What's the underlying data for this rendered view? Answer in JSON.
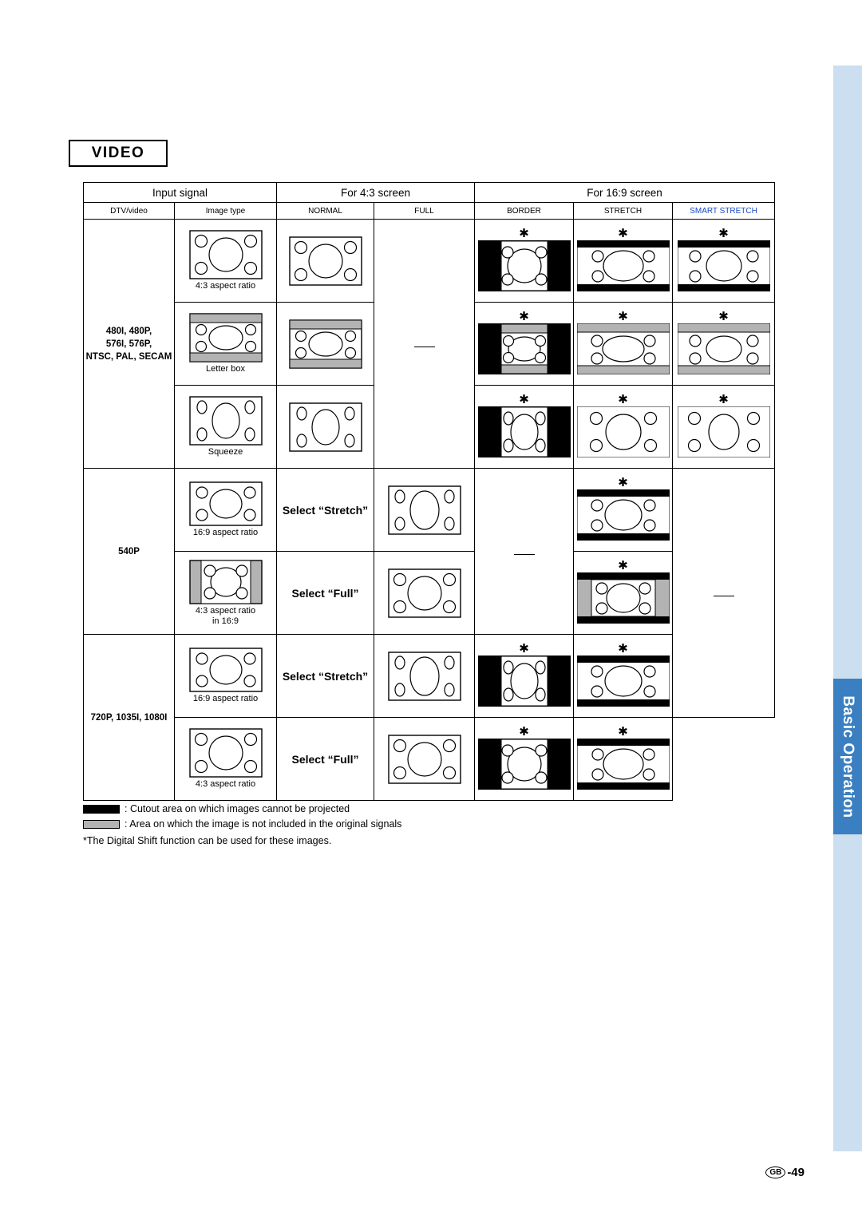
{
  "page": {
    "section_title": "VIDEO",
    "side_tab_label": "Basic Operation",
    "page_number": "-49",
    "page_region": "GB"
  },
  "table": {
    "group_headers": {
      "input_signal": "Input signal",
      "for_4_3": "For 4:3 screen",
      "for_16_9": "For 16:9 screen"
    },
    "column_headers": {
      "dtv_video": "DTV/video",
      "image_type": "Image type",
      "normal": "NORMAL",
      "full": "FULL",
      "border": "BORDER",
      "stretch": "STRETCH",
      "smart_stretch": "SMART STRETCH"
    },
    "rows": [
      {
        "signal": "480I, 480P,\n576I, 576P,\nNTSC, PAL, SECAM",
        "items": [
          {
            "image_type": "4:3 aspect ratio",
            "normal": "",
            "full": "",
            "border": "",
            "stretch": "",
            "smart_stretch": ""
          },
          {
            "image_type": "Letter box",
            "normal": "",
            "full": "",
            "border": "",
            "stretch": "",
            "smart_stretch": ""
          },
          {
            "image_type": "Squeeze",
            "normal": "",
            "full": "",
            "border": "",
            "stretch": "",
            "smart_stretch": ""
          }
        ]
      },
      {
        "signal": "540P",
        "items": [
          {
            "image_type": "16:9 aspect ratio",
            "normal": "Select “Stretch”",
            "full": "",
            "border": "",
            "stretch": "",
            "smart_stretch": ""
          },
          {
            "image_type": "4:3 aspect ratio\nin 16:9",
            "normal": "Select “Full”",
            "full": "",
            "border": "",
            "stretch": "",
            "smart_stretch": ""
          }
        ]
      },
      {
        "signal": "720P, 1035I, 1080I",
        "items": [
          {
            "image_type": "16:9 aspect ratio",
            "normal": "Select “Stretch”",
            "full": "",
            "border": "",
            "stretch": "",
            "smart_stretch": ""
          },
          {
            "image_type": "4:3 aspect ratio",
            "normal": "Select “Full”",
            "full": "",
            "border": "",
            "stretch": "",
            "smart_stretch": ""
          }
        ]
      }
    ]
  },
  "legend": {
    "black_label": ": Cutout area on which images cannot be projected",
    "gray_label": ": Area on which the image is not included in the original signals",
    "note": "*The Digital Shift function can be used for these images."
  },
  "colors": {
    "smart_stretch_header": "#1b48c4",
    "side_tab": "#3a7fc1",
    "side_strip": "#ccdff0",
    "cutout_area": "#000000",
    "not_included_area": "#b3b3b3"
  }
}
